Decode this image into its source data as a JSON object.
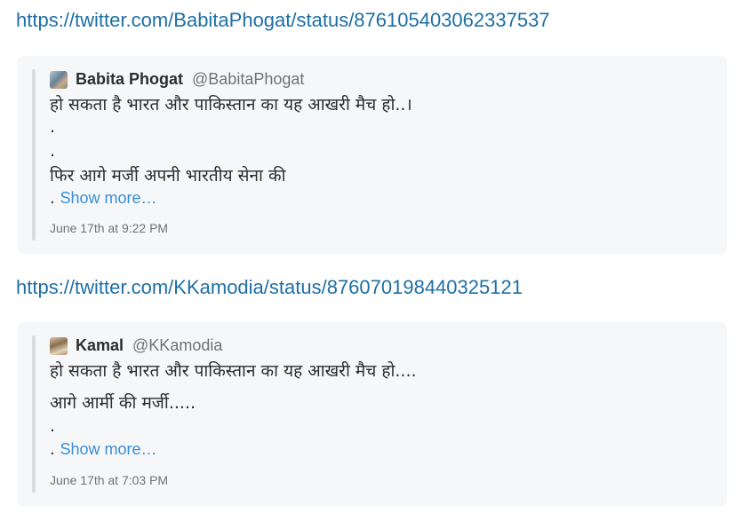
{
  "messages": [
    {
      "url": "https://twitter.com/BabitaPhogat/status/876105403062337537",
      "author": "Babita Phogat",
      "handle": "@BabitaPhogat",
      "lines": [
        "हो सकता है भारत और पाकिस्तान का यह आखरी मैच हो..।",
        ".",
        ".",
        "फिर आगे मर्जी अपनी भारतीय सेना की"
      ],
      "dot": ".",
      "show_more": "Show more…",
      "timestamp": "June 17th at 9:22 PM"
    },
    {
      "url": "https://twitter.com/KKamodia/status/876070198440325121",
      "author": "Kamal",
      "handle": "@KKamodia",
      "lines": [
        "हो सकता है भारत और पाकिस्तान का यह आखरी मैच हो....",
        "आगे आर्मी  की मर्जी.....",
        "."
      ],
      "dot": ".",
      "show_more": "Show more…",
      "timestamp": "June 17th at 7:03 PM"
    }
  ],
  "colors": {
    "link": "#1d6fa5",
    "show_more": "#3a8ed6",
    "card_bg": "#f6f7f8"
  }
}
